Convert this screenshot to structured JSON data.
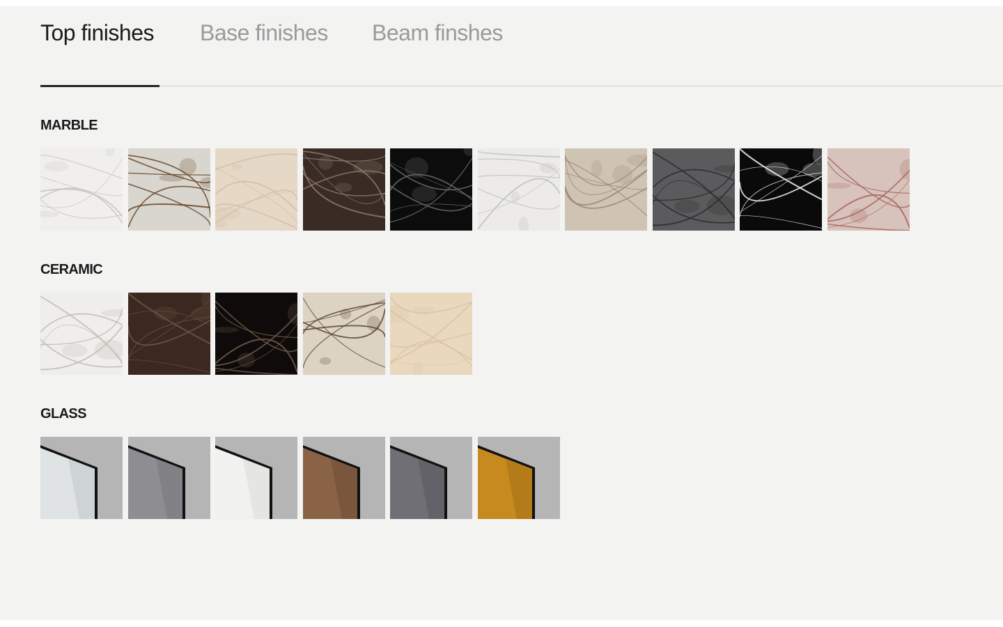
{
  "tabs": [
    {
      "label": "Top finishes",
      "active": true
    },
    {
      "label": "Base finishes",
      "active": false
    },
    {
      "label": "Beam finshes",
      "active": false
    }
  ],
  "sections": {
    "marble": {
      "title": "MARBLE",
      "swatches": [
        {
          "name": "calacatta-white",
          "base": "#f1efec",
          "vein": "#c9c6c1"
        },
        {
          "name": "patagonia-quartzite",
          "base": "#d9d6cf",
          "vein": "#6b4a2c"
        },
        {
          "name": "travertine-beige",
          "base": "#e6d8c6",
          "vein": "#cfbca5"
        },
        {
          "name": "emperador-dark",
          "base": "#3a2c25",
          "vein": "#8c7a6d"
        },
        {
          "name": "nero-marquina",
          "base": "#0c0c0c",
          "vein": "#6a6a6a"
        },
        {
          "name": "statuario-white",
          "base": "#ecebea",
          "vein": "#bdbdbd"
        },
        {
          "name": "taupe-breccia",
          "base": "#cfc4b4",
          "vein": "#9d8a72"
        },
        {
          "name": "grey-onyx",
          "base": "#5b5b5d",
          "vein": "#2b2b2d"
        },
        {
          "name": "black-white-vein",
          "base": "#0a0a0a",
          "vein": "#f2f2f2"
        },
        {
          "name": "rosa-onyx",
          "base": "#d8c3bc",
          "vein": "#a86a64"
        }
      ]
    },
    "ceramic": {
      "title": "CERAMIC",
      "swatches": [
        {
          "name": "ceramic-calacatta",
          "base": "#efeeeb",
          "vein": "#bebbb5"
        },
        {
          "name": "ceramic-brown-emperador",
          "base": "#3b2921",
          "vein": "#6e5243"
        },
        {
          "name": "ceramic-sahara-noir",
          "base": "#0e0b0a",
          "vein": "#6e5a47"
        },
        {
          "name": "ceramic-patagonia",
          "base": "#ddd3c2",
          "vein": "#5b4636"
        },
        {
          "name": "ceramic-travertine",
          "base": "#ead8be",
          "vein": "#d8c4a6"
        }
      ]
    },
    "glass": {
      "title": "GLASS",
      "swatches": [
        {
          "name": "glass-extra-clear",
          "pane": "#dfe3e4",
          "shade": "#aeb6b8"
        },
        {
          "name": "glass-grey",
          "pane": "#8e8e92",
          "shade": "#6b6b70"
        },
        {
          "name": "glass-white-textured",
          "pane": "#f1f1ef",
          "shade": "#cfcfcd"
        },
        {
          "name": "glass-bronze-textured",
          "pane": "#8a6346",
          "shade": "#5c3f2b"
        },
        {
          "name": "glass-smoke-textured",
          "pane": "#6f6f75",
          "shade": "#4a4a50"
        },
        {
          "name": "glass-gold",
          "pane": "#c78a1f",
          "shade": "#8f5e12"
        }
      ]
    }
  },
  "colors": {
    "background": "#f3f3f2",
    "text_active": "#1a1a1a",
    "text_inactive": "#9a9a9a",
    "glass_backdrop": "#b5b5b5"
  }
}
